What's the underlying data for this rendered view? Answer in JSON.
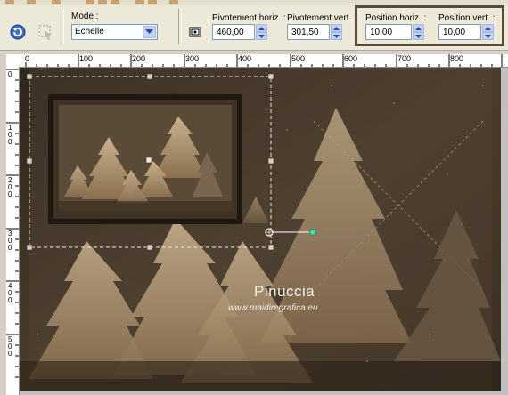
{
  "toolbar": {
    "mode_label": "Mode :",
    "mode_value": "Échelle",
    "pivot_h_label": "Pivotement horiz. :",
    "pivot_h_value": "460,00",
    "pivot_v_label": "Pivotement vert. :",
    "pivot_v_value": "301,50",
    "pos_h_label": "Position horiz. :",
    "pos_h_value": "10,00",
    "pos_v_label": "Position vert. :",
    "pos_v_value": "10,00"
  },
  "ruler": {
    "h_ticks": [
      "0",
      "100",
      "200",
      "300",
      "400",
      "500",
      "600",
      "700",
      "800"
    ],
    "v_ticks": [
      "0",
      "100",
      "200",
      "300",
      "400",
      "500"
    ]
  },
  "watermark": {
    "name": "Pinuccia",
    "url": "www.maidiregrafica.eu"
  },
  "colors": {
    "accent_box": "#5a4a3a",
    "image_bg": "#4a3d2c"
  }
}
